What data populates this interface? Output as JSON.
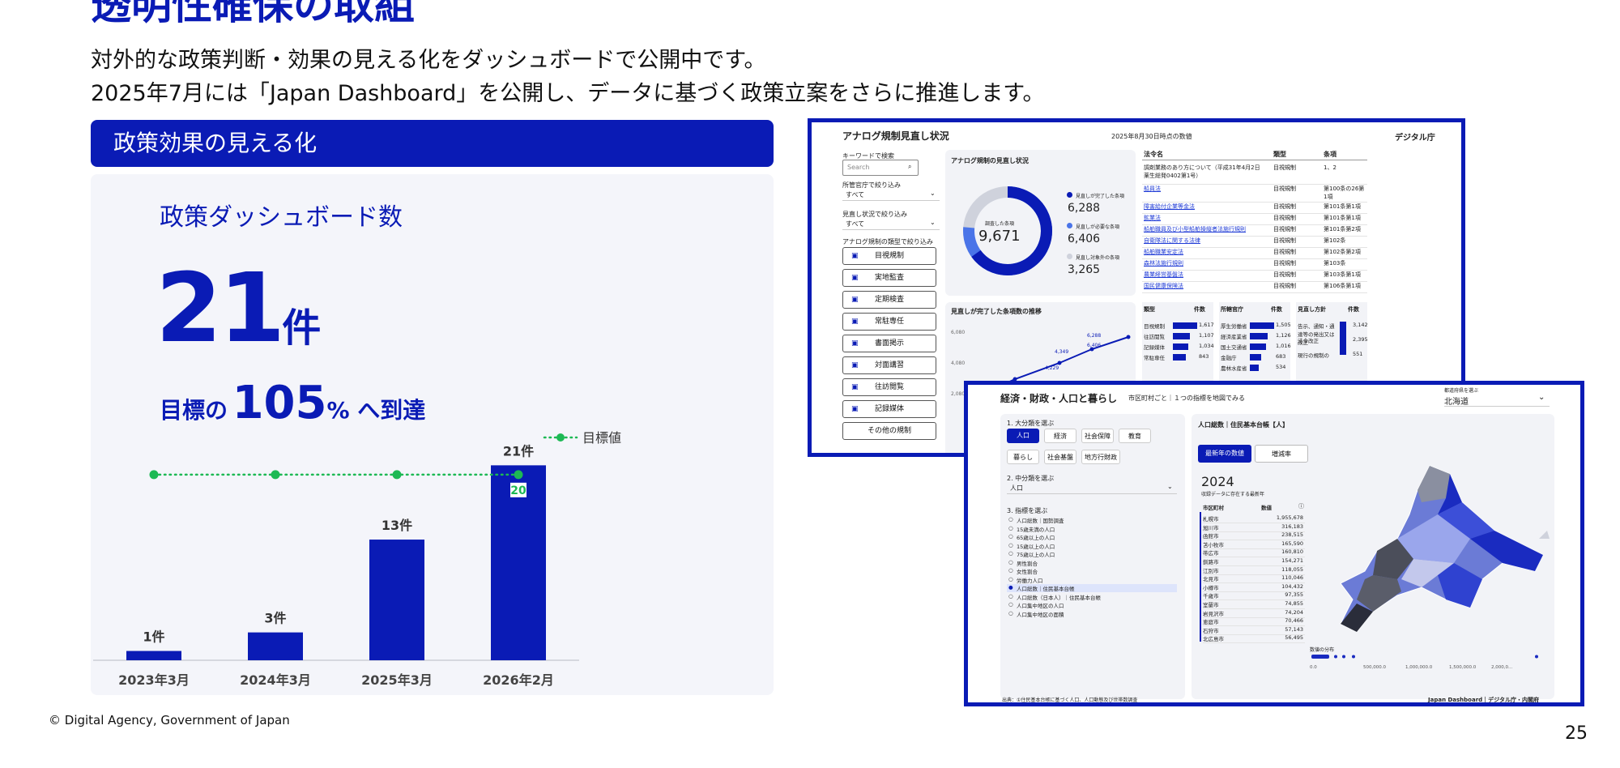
{
  "page": {
    "title": "透明性確保の取組",
    "subtitle_line1": "対外的な政策判断・効果の見える化をダッシュボードで公開中です。",
    "subtitle_line2": "2025年7月には「Japan Dashboard」を公開し、データに基づく政策立案をさらに推進します。",
    "copyright": "© Digital Agency, Government of Japan",
    "page_number": "25"
  },
  "section": {
    "header": "政策効果の見える化",
    "panel_title": "政策ダッシュボード数",
    "count_number": "21",
    "count_unit": "件",
    "goal_prefix": "目標の",
    "goal_number": "105",
    "goal_suffix": "% へ到達"
  },
  "chart_data": {
    "type": "bar",
    "categories": [
      "2023年3月",
      "2024年3月",
      "2025年3月",
      "2026年2月"
    ],
    "series": [
      {
        "values": [
          1,
          3,
          13,
          21
        ],
        "value_labels": [
          "1件",
          "3件",
          "13件",
          "21件"
        ]
      },
      {
        "name": "目標値",
        "type": "line",
        "values": [
          20,
          20,
          20,
          20
        ],
        "value_labels": [
          "",
          "",
          "",
          "20"
        ]
      }
    ],
    "ylim": [
      0,
      24
    ],
    "legend": "top-right",
    "colors": {
      "bar": "#0a1bb5",
      "target": "#1db954"
    }
  },
  "shot1": {
    "title": "アナログ規制見直し状況",
    "date": "2025年8月30日時点の数値",
    "org": "デジタル庁",
    "keyword_label": "キーワードで検索",
    "search_placeholder": "Search",
    "filter1_label": "所管官庁で絞り込み",
    "filter1_value": "すべて",
    "filter2_label": "見直し状況で絞り込み",
    "filter2_value": "すべて",
    "filter3_label": "アナログ規制の類型で絞り込み",
    "types": [
      "目視規制",
      "実地監査",
      "定期検査",
      "常駐専任",
      "書面掲示",
      "対面講習",
      "往訪閲覧",
      "記録媒体",
      "その他の規制"
    ],
    "donut_title": "アナログ規制の見直し状況",
    "donut_center_label": "調査した条項",
    "donut_center_value": "9,671",
    "legend": [
      {
        "label": "見直しが完了した条項",
        "value": "6,288",
        "color": "#0a1bb5"
      },
      {
        "label": "見直しが必要な条項",
        "value": "6,406",
        "color": "#4a74e8"
      },
      {
        "label": "見直し対象外の条項",
        "value": "3,265",
        "color": "#cfd2dc"
      }
    ],
    "trend_title": "見直しが完了した条項数の推移",
    "trend_axis": [
      "6,080",
      "4,080",
      "2,080"
    ],
    "trend_points": [
      "2,580",
      "4,229",
      "4,349",
      "6,288",
      "6,406"
    ],
    "table_headers": [
      "法令名",
      "類型",
      "条項"
    ],
    "table_rows": [
      [
        "調剤業務のあり方について（平成31年4月2日薬生総発0402第1号）",
        "目視規制",
        "1、2"
      ],
      [
        "船員法",
        "目視規制",
        "第100条の26第1項"
      ],
      [
        "障害給付企業等金法",
        "目視規制",
        "第101条第1項"
      ],
      [
        "鉱業法",
        "目視規制",
        "第101条第1項"
      ],
      [
        "船舶職員及び小型船舶操縦者法施行規則",
        "目視規制",
        "第101条第2項"
      ],
      [
        "自衛隊法に関する法律",
        "目視規制",
        "第102条"
      ],
      [
        "船舶職業安定法",
        "目視規制",
        "第102条第2項"
      ],
      [
        "森林法施行規則",
        "目視規制",
        "第103条"
      ],
      [
        "農業経営基盤法",
        "目視規制",
        "第103条第1項"
      ],
      [
        "国民健康保険法",
        "目視規制",
        "第106条第1項"
      ]
    ],
    "mini1_headers": [
      "類型",
      "件数"
    ],
    "mini1_rows": [
      [
        "目視規制",
        "1,617"
      ],
      [
        "往訪閲覧",
        "1,107"
      ],
      [
        "記録媒体",
        "1,034"
      ],
      [
        "常駐専任",
        "843"
      ]
    ],
    "mini2_headers": [
      "所轄官庁",
      "件数"
    ],
    "mini2_rows": [
      [
        "厚生労働省",
        "1,505"
      ],
      [
        "経済産業省",
        "1,126"
      ],
      [
        "国土交通省",
        "1,016"
      ],
      [
        "金融庁",
        "683"
      ],
      [
        "農林水産省",
        "534"
      ]
    ],
    "mini3_headers": [
      "見直し方針",
      "件数"
    ],
    "mini3_rows": [
      [
        "告示、通知・通達等の発出又は改正",
        "3,142"
      ],
      [
        "法令改正",
        "2,395"
      ],
      [
        "現行の規制の",
        "551"
      ]
    ]
  },
  "shot2": {
    "title": "経済・財政・人口と暮らし",
    "title_sub": "市区町村ごと｜１つの指標を地図でみる",
    "pref_label": "都道府県を選ぶ",
    "pref_value": "北海道",
    "step1": "1. 大分類を選ぶ",
    "categories": [
      "人口",
      "経済",
      "社会保障",
      "教育",
      "暮らし",
      "社会基盤",
      "地方行財政"
    ],
    "step2": "2. 中分類を選ぶ",
    "step2_value": "人口",
    "step3": "3. 指標を選ぶ",
    "indicators": [
      "人口総数｜国勢調査",
      "15歳未満の人口",
      "65歳以上の人口",
      "15歳以上の人口",
      "75歳以上の人口",
      "男性割合",
      "女性割合",
      "労働力人口",
      "人口総数｜住民基本台帳",
      "人口総数（日本人）｜住民基本台帳",
      "人口集中地区の人口",
      "人口集中地区の面積"
    ],
    "right_title": "人口総数｜住民基本台帳【人】",
    "tab_active": "最新年の数値",
    "tab_inactive": "増減率",
    "year": "2024",
    "year_note": "収録データに存在する最新年",
    "table_header_city": "市区町村",
    "table_header_value": "数値",
    "rows": [
      [
        "札幌市",
        "1,955,678"
      ],
      [
        "旭川市",
        "316,183"
      ],
      [
        "函館市",
        "238,515"
      ],
      [
        "苫小牧市",
        "165,590"
      ],
      [
        "帯広市",
        "160,810"
      ],
      [
        "釧路市",
        "154,271"
      ],
      [
        "江別市",
        "118,055"
      ],
      [
        "北見市",
        "110,046"
      ],
      [
        "小樽市",
        "104,432"
      ],
      [
        "千歳市",
        "97,355"
      ],
      [
        "室蘭市",
        "74,855"
      ],
      [
        "岩見沢市",
        "74,204"
      ],
      [
        "恵庭市",
        "70,466"
      ],
      [
        "石狩市",
        "57,143"
      ],
      [
        "北広島市",
        "56,495"
      ]
    ],
    "dist_label": "数値の分布",
    "dist_ticks": [
      "0.0",
      "500,000.0",
      "1,000,000.0",
      "1,500,000.0",
      "2,000,0..."
    ],
    "source": "出典：①住民基本台帳に基づく人口、人口動態及び世帯数調査",
    "footer": "Japan Dashboard｜デジタル庁・内閣府"
  }
}
